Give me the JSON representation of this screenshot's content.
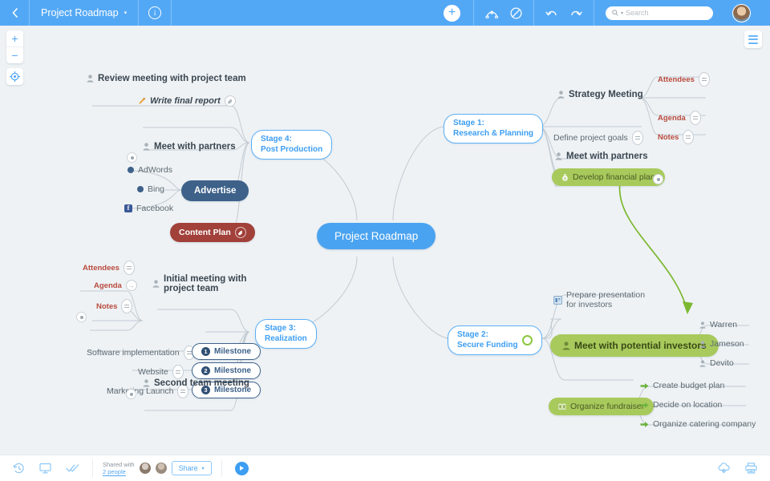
{
  "topbar": {
    "back_icon": "chevron-left-icon",
    "title": "Project Roadmap",
    "caret": "▾",
    "info_icon": "info-icon",
    "add_icon": "plus-icon",
    "relationship_icon": "relationship-icon",
    "boundary_icon": "no-entry-icon",
    "undo_icon": "undo-icon",
    "redo_icon": "redo-icon",
    "search_placeholder": "Search",
    "search_value": "",
    "search_icon": "search-icon",
    "avatar": "user-avatar"
  },
  "canvas": {
    "zoom_in": "+",
    "zoom_out": "−",
    "center_icon": "center-target-icon",
    "menu_icon": "hamburger-menu-icon",
    "background": "#eef2f5"
  },
  "map": {
    "root": "Project Roadmap",
    "stages": [
      {
        "id": "s1",
        "label": "Stage 1:\nResearch & Planning",
        "badge": ""
      },
      {
        "id": "s2",
        "label": "Stage 2:\nSecure Funding",
        "badge": "green-ring"
      },
      {
        "id": "s3",
        "label": "Stage 3:\nRealization",
        "badge": ""
      },
      {
        "id": "s4",
        "label": "Stage 4:\nPost Production",
        "badge": ""
      }
    ],
    "stage1_nodes": {
      "strategy_meeting": "Strategy Meeting",
      "attendees": "Attendees",
      "agenda": "Agenda",
      "notes": "Notes",
      "define_goals": "Define project goals",
      "meet_partners": "Meet with partners",
      "financial_plan": "Develop financial plan"
    },
    "stage2_nodes": {
      "prepare_presentation": "Prepare presentation\nfor investors",
      "meet_investors": "Meet with potential investors",
      "warren": "Warren",
      "jameson": "Jameson",
      "devito": "Devito",
      "organize_fundraiser": "Organize fundraiser",
      "budget_plan": "Create budget plan",
      "decide_location": "Decide on location",
      "catering": "Organize catering company"
    },
    "stage3_nodes": {
      "initial_meeting": "Initial meeting with\nproject team",
      "attendees": "Attendees",
      "agenda": "Agenda",
      "notes": "Notes",
      "software": "Software implementation",
      "website": "Website",
      "marketing": "Marketing Launch",
      "milestone1": "Milestone",
      "milestone2": "Milestone",
      "milestone3": "Milestone",
      "milestone1_num": "1",
      "milestone2_num": "2",
      "milestone3_num": "3",
      "second_meeting": "Second team meeting"
    },
    "stage4_nodes": {
      "review_meeting": "Review meeting with project team",
      "write_report": "Write final report",
      "meet_partners": "Meet with partners",
      "adwords": "AdWords",
      "bing": "Bing",
      "facebook": "Facebook",
      "advertise": "Advertise",
      "content_plan": "Content Plan"
    },
    "colors": {
      "accent": "#53a8f5",
      "root_fill": "#4aa3f0",
      "green_pill": "#a8ca5c",
      "dark_blue_pill": "#3d6189",
      "dark_red_pill": "#a1413a",
      "red_text": "#b94a3d",
      "link_line": "#c3cbd2",
      "relation_arrow": "#7cb82f"
    }
  },
  "bottombar": {
    "history_icon": "history-clock-icon",
    "presentation_icon": "presentation-icon",
    "tasks_icon": "double-check-icon",
    "shared_label": "Shared with",
    "shared_count": "2 people",
    "share_button": "Share",
    "share_caret": "▾",
    "play_icon": "play-icon",
    "export_icon": "cloud-download-icon",
    "print_icon": "print-icon"
  }
}
